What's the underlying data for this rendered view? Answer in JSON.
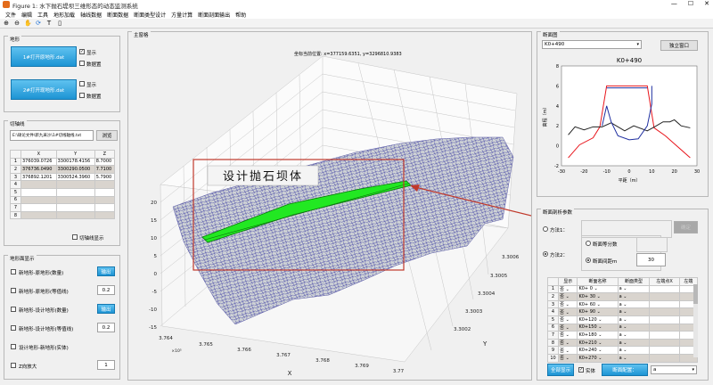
{
  "window": {
    "title": "Figure 1: 水下抛石堤坝三维形态的动态监测系统",
    "min": "—",
    "max": "☐",
    "close": "✕"
  },
  "menu": [
    "文件",
    "编辑",
    "工具",
    "地形加载",
    "轴线数据",
    "断面数据",
    "断面类型设计",
    "方量计算",
    "断面剖面输出",
    "帮助"
  ],
  "toolbar": {
    "icons": [
      "zoom-in-icon",
      "zoom-out-icon",
      "pan-icon",
      "rotate-icon",
      "datatip-icon",
      "colorbar-icon"
    ]
  },
  "terrain_panel": {
    "title": "地形",
    "btn1": "1#打开原地形.dat",
    "btn2": "2#打开现地形.dat",
    "show1": "显示",
    "scatter1": "数据置",
    "show2": "显示",
    "scatter2": "数据置"
  },
  "axis_panel": {
    "title": "切轴线",
    "path": "E:\\硕论文件\\新九采沙\\1#切线轴线.txt",
    "browse": "浏览",
    "headers": [
      "X",
      "Y",
      "Z"
    ],
    "rows": [
      [
        "1",
        "376039.0726",
        "3300178.4156",
        "8.7000"
      ],
      [
        "2",
        "376736.0490",
        "3300290.0500",
        "7.7100"
      ],
      [
        "3",
        "376892.1201",
        "3300524.3960",
        "5.7900"
      ],
      [
        "4",
        "",
        "",
        ""
      ],
      [
        "5",
        "",
        "",
        ""
      ],
      [
        "6",
        "",
        "",
        ""
      ],
      [
        "7",
        "",
        "",
        ""
      ],
      [
        "8",
        "",
        "",
        ""
      ]
    ],
    "show": "切轴线显示"
  },
  "display_panel": {
    "title": "地形面显示",
    "items": [
      {
        "label": "新地形-原地形(数量)",
        "btn": "输出"
      },
      {
        "label": "新地形-原地形(等值线)",
        "val": "0.2"
      },
      {
        "label": "新地形-设计地形(数量)",
        "btn": "输出"
      },
      {
        "label": "新地形-设计地形(等值线)",
        "val": "0.2"
      },
      {
        "label": "设计地形-新地形(实体)"
      },
      {
        "label": "Z向放大",
        "val": "1"
      }
    ]
  },
  "main_view": {
    "title": "主窗格",
    "coord": "坐标当前位置: x=377159.6351, y=3296810.9383",
    "annotation": "设计抛石坝体",
    "x_ticks": [
      "3.764",
      "3.765",
      "3.766",
      "3.767",
      "3.768",
      "3.769",
      "3.77"
    ],
    "x_exp": "×10⁵",
    "x_label": "X",
    "y_ticks": [
      "3.3002",
      "3.3003",
      "3.3004",
      "3.3005",
      "3.3006"
    ],
    "y_label": "Y",
    "z_ticks": [
      "-15",
      "-10",
      "-5",
      "0",
      "5",
      "10",
      "15",
      "20"
    ]
  },
  "section_panel": {
    "title": "断面图",
    "select": "K0+490",
    "export": "独立窗口",
    "chart_title": "K0+490",
    "ylabel": "高程（m）",
    "xlabel": "平距（m）",
    "x_ticks": [
      "-30",
      "-20",
      "-10",
      "0",
      "10",
      "20",
      "30"
    ],
    "y_ticks": [
      "-2",
      "0",
      "2",
      "4",
      "6",
      "8"
    ]
  },
  "chart_data": {
    "type": "line",
    "title": "K0+490",
    "xlabel": "平距（m）",
    "ylabel": "高程（m）",
    "xlim": [
      -30,
      30
    ],
    "ylim": [
      -2,
      8
    ],
    "series": [
      {
        "color": "#e8141b",
        "x": [
          -27,
          -22,
          -16,
          -13,
          -10,
          8,
          11,
          16,
          20,
          27
        ],
        "y": [
          -1.2,
          0.1,
          0.8,
          1.9,
          6,
          6,
          1.8,
          1.0,
          0.2,
          -1.2
        ]
      },
      {
        "color": "#222222",
        "x": [
          -27,
          -24,
          -20,
          -16,
          -12,
          -8,
          -2,
          2,
          8,
          12,
          15,
          18,
          20,
          23,
          27
        ],
        "y": [
          1.1,
          1.9,
          1.6,
          1.9,
          1.9,
          2.3,
          1.5,
          2.0,
          1.5,
          2.0,
          2.4,
          2.4,
          2.6,
          2.0,
          1.8
        ]
      },
      {
        "color": "#1f2fa0",
        "x": [
          -12,
          -10,
          -8,
          -5,
          0,
          4,
          8,
          10,
          10
        ],
        "y": [
          2.0,
          4.0,
          2.4,
          1.0,
          0.6,
          0.7,
          2.0,
          4.2,
          6
        ]
      },
      {
        "color": "#1f2fa0",
        "x": [
          -10,
          8
        ],
        "y": [
          5.8,
          5.8
        ]
      }
    ]
  },
  "params_panel": {
    "title": "断面剖析参数",
    "method1": "方法1：",
    "method2": "方法2：",
    "btn_hidden": "确定",
    "seg_count": "断面等分数",
    "seg_dist": "断面间距m",
    "seg_val": "30",
    "table_headers": [
      "显示",
      "断面名称",
      "断面类型",
      "左端点X",
      "左端"
    ],
    "rows": [
      [
        "1",
        "否",
        "K0+ 0",
        "a"
      ],
      [
        "2",
        "否",
        "K0+ 30",
        "a"
      ],
      [
        "3",
        "否",
        "K0+ 60",
        "a"
      ],
      [
        "4",
        "否",
        "K0+ 90",
        "a"
      ],
      [
        "5",
        "否",
        "K0+120",
        "a"
      ],
      [
        "6",
        "否",
        "K0+150",
        "a"
      ],
      [
        "7",
        "否",
        "K0+180",
        "a"
      ],
      [
        "8",
        "否",
        "K0+210",
        "a"
      ],
      [
        "9",
        "否",
        "K0+240",
        "a"
      ],
      [
        "10",
        "否",
        "K0+270",
        "a"
      ]
    ],
    "btn_all": "全部显示",
    "chk_solid": "实体",
    "btn_cfg": "断面配置：",
    "cfg_val": "a"
  },
  "colors": {
    "accent": "#1d94d4",
    "green": "#22e822",
    "red_box": "#c0392b"
  }
}
